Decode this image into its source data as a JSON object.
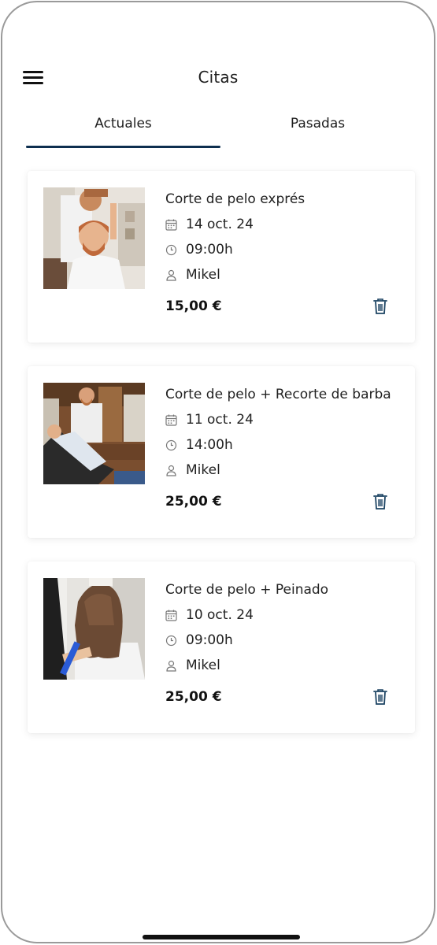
{
  "header": {
    "title": "Citas"
  },
  "tabs": [
    {
      "label": "Actuales",
      "active": true
    },
    {
      "label": "Pasadas",
      "active": false
    }
  ],
  "appointments": [
    {
      "service": "Corte de pelo exprés",
      "date": "14 oct. 24",
      "time": "09:00h",
      "staff": "Mikel",
      "price": "15,00 €"
    },
    {
      "service": "Corte de pelo + Recorte de barba",
      "date": "11 oct. 24",
      "time": "14:00h",
      "staff": "Mikel",
      "price": "25,00 €"
    },
    {
      "service": "Corte de pelo + Peinado",
      "date": "10 oct. 24",
      "time": "09:00h",
      "staff": "Mikel",
      "price": "25,00 €"
    }
  ],
  "icons": {
    "menu": "hamburger-menu-icon",
    "date": "calendar-icon",
    "time": "clock-icon",
    "staff": "person-icon",
    "delete": "trash-icon"
  },
  "colors": {
    "accent": "#0e2f4f",
    "text": "#1e1e1e"
  }
}
